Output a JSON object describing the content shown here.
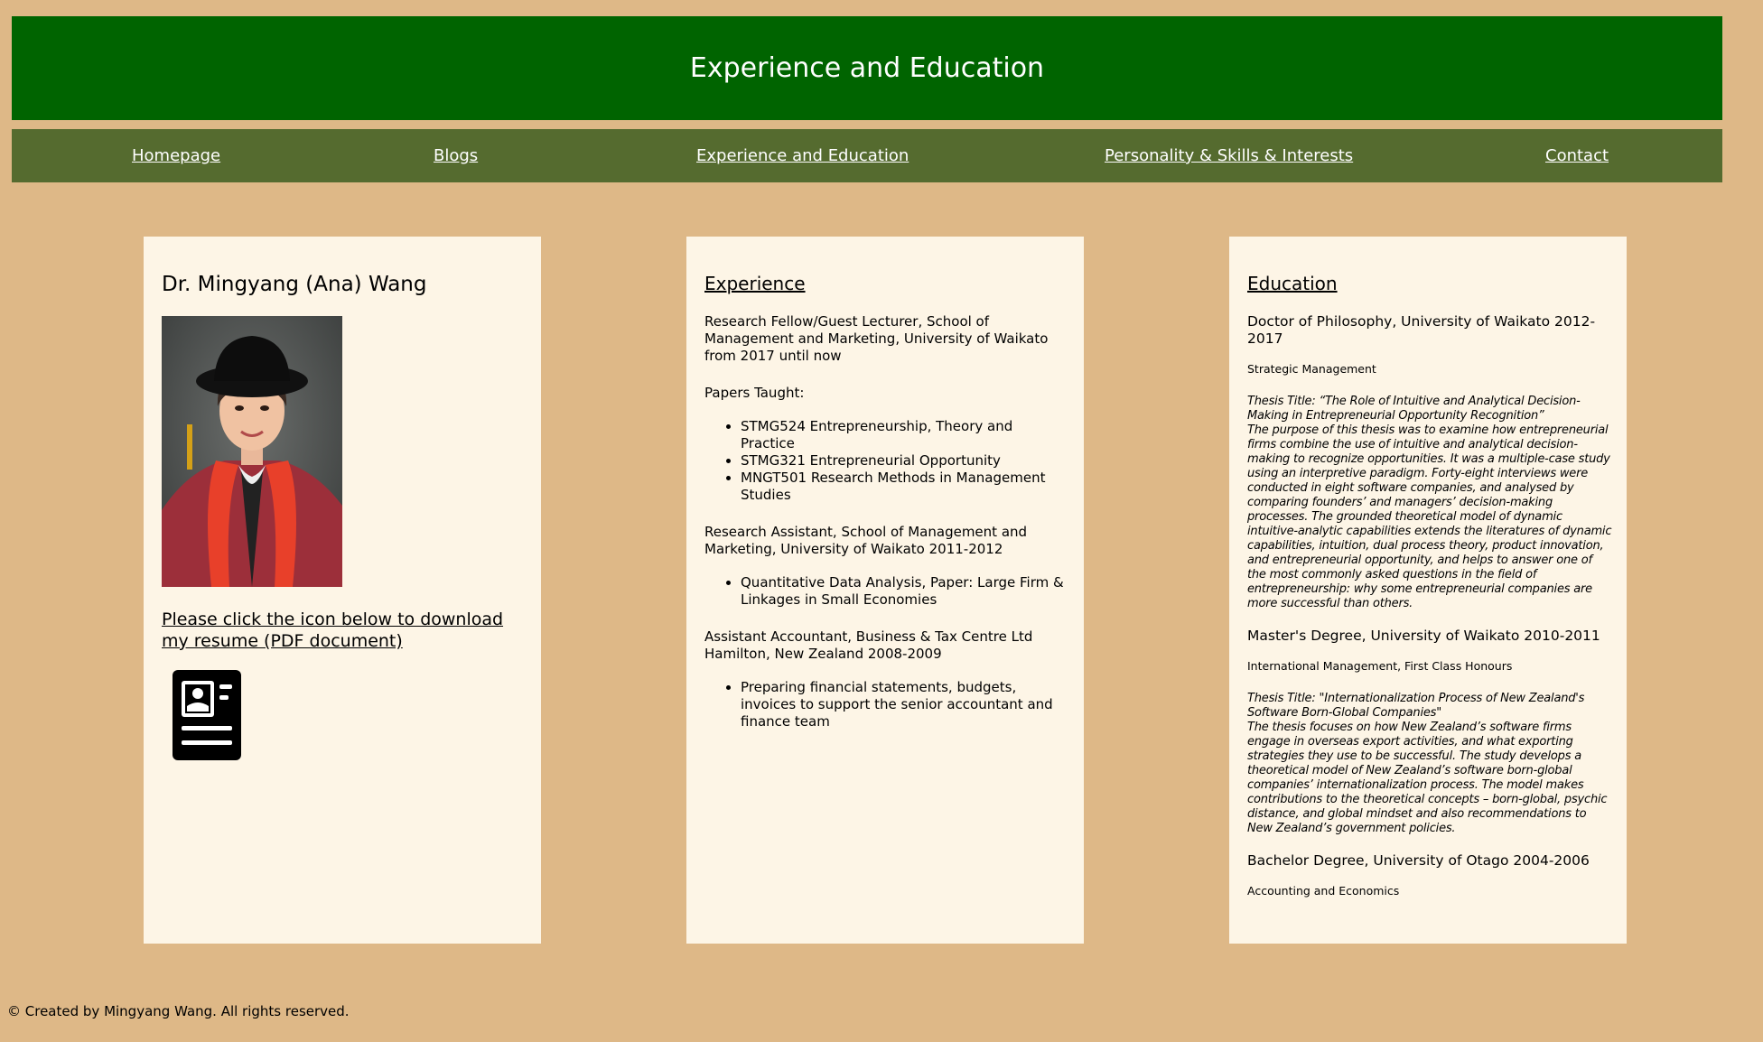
{
  "header": {
    "title": "Experience and Education"
  },
  "nav": {
    "items": [
      {
        "label": "Homepage"
      },
      {
        "label": "Blogs"
      },
      {
        "label": "Experience and Education"
      },
      {
        "label": "Personality & Skills & Interests"
      },
      {
        "label": "Contact"
      }
    ]
  },
  "profile": {
    "name": "Dr. Mingyang (Ana) Wang",
    "resume_link": "Please click the icon below to download my resume (PDF document)",
    "resume_icon": "resume-document-icon"
  },
  "experience": {
    "title": "Experience",
    "job1": "Research Fellow/Guest Lecturer, School of Management and Marketing, University of Waikato from 2017 until now",
    "papers_label": "Papers Taught:",
    "papers": [
      "STMG524 Entrepreneurship, Theory and Practice",
      "STMG321 Entrepreneurial Opportunity",
      "MNGT501 Research Methods in Management Studies"
    ],
    "job2": "Research Assistant, School of Management and Marketing, University of Waikato 2011-2012",
    "job2_items": [
      "Quantitative Data Analysis, Paper: Large Firm & Linkages in Small Economies"
    ],
    "job3": "Assistant Accountant, Business & Tax Centre Ltd Hamilton, New Zealand 2008-2009",
    "job3_items": [
      "Preparing financial statements, budgets, invoices to support the senior accountant and finance team"
    ]
  },
  "education": {
    "title": "Education",
    "phd": "Doctor of Philosophy, University of Waikato 2012-2017",
    "phd_field": "Strategic Management",
    "phd_thesis_title": "Thesis Title: “The Role of Intuitive and Analytical Decision-Making in Entrepreneurial Opportunity Recognition”",
    "phd_thesis_body": "The purpose of this thesis was to examine how entrepreneurial firms combine the use of intuitive and analytical decision-making to recognize opportunities. It was a multiple-case study using an interpretive paradigm. Forty-eight interviews were conducted in eight software companies, and analysed by comparing founders’ and managers’ decision-making processes. The grounded theoretical model of dynamic intuitive-analytic capabilities extends the literatures of dynamic capabilities, intuition, dual process theory, product innovation, and entrepreneurial opportunity, and helps to answer one of the most commonly asked questions in the field of entrepreneurship: why some entrepreneurial companies are more successful than others.",
    "masters": "Master's Degree, University of Waikato 2010-2011",
    "masters_field": "International Management, First Class Honours",
    "masters_thesis_title": "Thesis Title: \"Internationalization Process of New Zealand's Software Born-Global Companies\"",
    "masters_thesis_body": "The thesis focuses on how New Zealand’s software firms engage in overseas export activities, and what exporting strategies they use to be successful. The study develops a theoretical model of New Zealand’s software born-global companies’ internationalization process. The model makes contributions to the theoretical concepts – born-global, psychic distance, and global mindset and also recommendations to New Zealand’s government policies.",
    "bachelor": "Bachelor Degree, University of Otago 2004-2006",
    "bachelor_field": "Accounting and Economics"
  },
  "footer": {
    "text": "© Created by Mingyang Wang. All rights reserved."
  },
  "colors": {
    "page_bg": "#deb887",
    "header_bg": "#006400",
    "nav_bg": "#556b2f",
    "card_bg": "#fdf5e6"
  }
}
